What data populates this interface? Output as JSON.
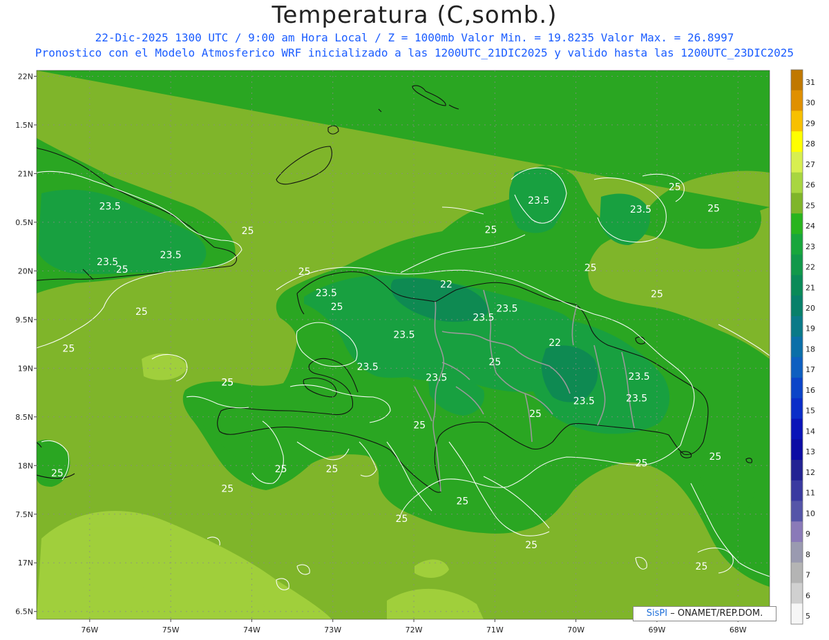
{
  "header": {
    "title": "Temperatura (C,somb.)",
    "line1": "22-Dic-2025  1300 UTC / 9:00 am Hora Local / Z = 1000mb   Valor Min. = 19.8235  Valor Max. = 26.8997",
    "line2": "Pronostico con el Modelo Atmosferico WRF inicializado a las 1200UTC_21DIC2025 y valido hasta las  1200UTC_23DIC2025"
  },
  "axes": {
    "lat_labels": [
      "22N",
      "1.5N",
      "21N",
      "0.5N",
      "20N",
      "9.5N",
      "19N",
      "8.5N",
      "18N",
      "7.5N",
      "17N",
      "6.5N"
    ],
    "lon_labels": [
      "76W",
      "75W",
      "74W",
      "73W",
      "72W",
      "71W",
      "70W",
      "69W",
      "68W"
    ]
  },
  "colorbar": {
    "labels": [
      "31",
      "30",
      "29",
      "28",
      "27",
      "26",
      "25",
      "24",
      "23",
      "22",
      "21",
      "20",
      "19",
      "18",
      "17",
      "16",
      "15",
      "14",
      "13",
      "12",
      "11",
      "10",
      "9",
      "8",
      "7",
      "6",
      "5"
    ],
    "colors": [
      "#c07800",
      "#e09000",
      "#f8c000",
      "#ffff00",
      "#d8ef50",
      "#a8d640",
      "#7fb52a",
      "#28b41e",
      "#18a63c",
      "#11984a",
      "#0a8a58",
      "#08806a",
      "#0a7a88",
      "#0b6fa8",
      "#0e5fc0",
      "#0b44c8",
      "#0a2dc8",
      "#0a14b8",
      "#0c0ca4",
      "#232393",
      "#3a3aa0",
      "#5555a8",
      "#8a7ab8",
      "#9a9ab0",
      "#b4b4b4",
      "#d0d0d0",
      "#f6f6f6"
    ]
  },
  "contour_labels": [
    {
      "text": "23.5",
      "lon": -75.75,
      "lat": 20.63
    },
    {
      "text": "23.5",
      "lon": -75.78,
      "lat": 20.06
    },
    {
      "text": "25",
      "lon": -75.6,
      "lat": 19.98
    },
    {
      "text": "23.5",
      "lon": -75.0,
      "lat": 20.13
    },
    {
      "text": "25",
      "lon": -74.05,
      "lat": 20.38
    },
    {
      "text": "25",
      "lon": -75.36,
      "lat": 19.55
    },
    {
      "text": "25",
      "lon": -76.26,
      "lat": 19.17
    },
    {
      "text": "25",
      "lon": -73.35,
      "lat": 19.96
    },
    {
      "text": "23.5",
      "lon": -73.08,
      "lat": 19.74
    },
    {
      "text": "25",
      "lon": -72.95,
      "lat": 19.6
    },
    {
      "text": "22",
      "lon": -71.6,
      "lat": 19.83
    },
    {
      "text": "23.5",
      "lon": -71.14,
      "lat": 19.49
    },
    {
      "text": "23.5",
      "lon": -70.85,
      "lat": 19.58
    },
    {
      "text": "25",
      "lon": -71.05,
      "lat": 20.39
    },
    {
      "text": "23.5",
      "lon": -70.46,
      "lat": 20.69
    },
    {
      "text": "25",
      "lon": -69.82,
      "lat": 20.0
    },
    {
      "text": "25",
      "lon": -69.0,
      "lat": 19.73
    },
    {
      "text": "25",
      "lon": -68.78,
      "lat": 20.83
    },
    {
      "text": "23.5",
      "lon": -69.2,
      "lat": 20.6
    },
    {
      "text": "25",
      "lon": -68.3,
      "lat": 20.61
    },
    {
      "text": "22",
      "lon": -70.26,
      "lat": 19.23
    },
    {
      "text": "23.5",
      "lon": -72.12,
      "lat": 19.31
    },
    {
      "text": "23.5",
      "lon": -72.57,
      "lat": 18.98
    },
    {
      "text": "25",
      "lon": -71.0,
      "lat": 19.03
    },
    {
      "text": "23.5",
      "lon": -71.72,
      "lat": 18.87
    },
    {
      "text": "23.5",
      "lon": -69.9,
      "lat": 18.63
    },
    {
      "text": "23.5",
      "lon": -69.22,
      "lat": 18.88
    },
    {
      "text": "23.5",
      "lon": -69.25,
      "lat": 18.66
    },
    {
      "text": "25",
      "lon": -70.5,
      "lat": 18.5
    },
    {
      "text": "25",
      "lon": -71.93,
      "lat": 18.38
    },
    {
      "text": "25",
      "lon": -74.3,
      "lat": 18.82
    },
    {
      "text": "25",
      "lon": -74.3,
      "lat": 18.82
    },
    {
      "text": "25",
      "lon": -73.64,
      "lat": 17.93
    },
    {
      "text": "25",
      "lon": -73.01,
      "lat": 17.93
    },
    {
      "text": "25",
      "lon": -74.3,
      "lat": 17.73
    },
    {
      "text": "25",
      "lon": -72.15,
      "lat": 17.42
    },
    {
      "text": "25",
      "lon": -71.4,
      "lat": 17.6
    },
    {
      "text": "25",
      "lon": -70.55,
      "lat": 17.15
    },
    {
      "text": "25",
      "lon": -69.19,
      "lat": 17.99
    },
    {
      "text": "25",
      "lon": -68.28,
      "lat": 18.06
    },
    {
      "text": "25",
      "lon": -76.4,
      "lat": 17.89
    },
    {
      "text": "25",
      "lon": -68.45,
      "lat": 16.93
    }
  ],
  "credit": {
    "brand": "SisPI",
    "rest": " –  ONAMET/REP.DOM."
  }
}
